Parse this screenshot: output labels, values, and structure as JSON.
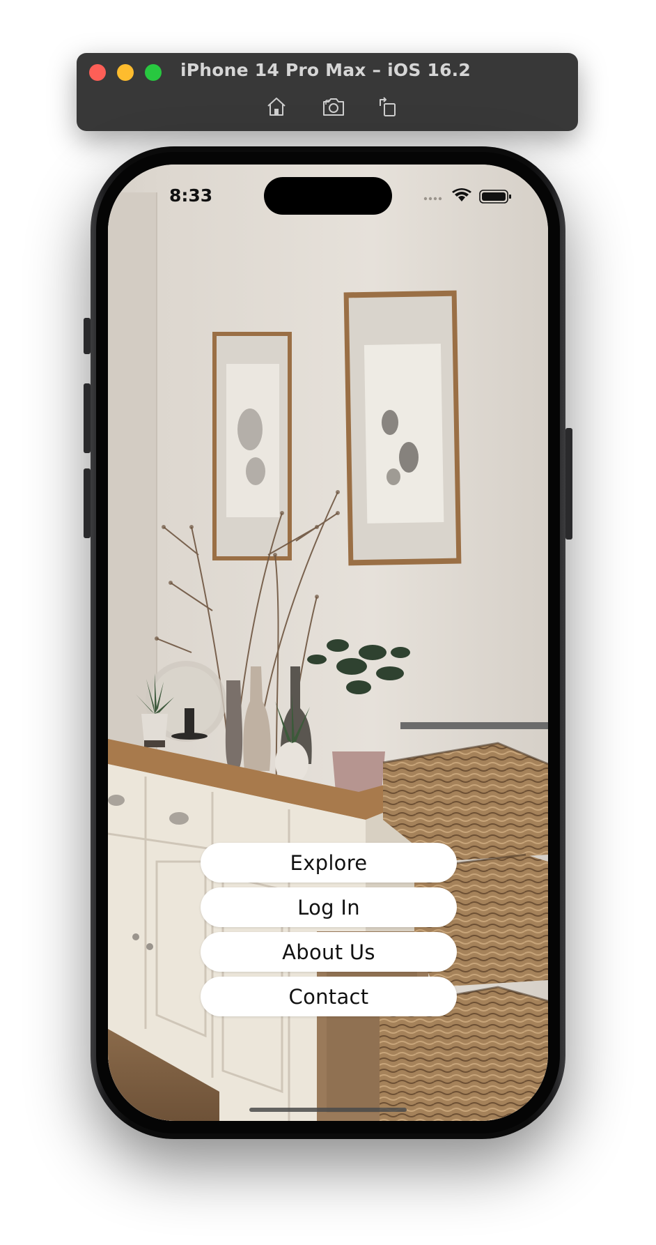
{
  "simulator": {
    "title": "iPhone 14 Pro Max – iOS 16.2",
    "tools": [
      "home-icon",
      "screenshot-icon",
      "rotate-icon"
    ]
  },
  "status_bar": {
    "time": "8:33",
    "icons": [
      "signal-icon",
      "wifi-icon",
      "battery-icon"
    ]
  },
  "menu": {
    "explore": "Explore",
    "login": "Log In",
    "about": "About Us",
    "contact": "Contact"
  },
  "colors": {
    "button_bg": "#ffffff",
    "button_text": "#111111",
    "wall": "#e2ddd6",
    "sideboard": "#ece6da",
    "wood_top": "#a87a4c",
    "wicker": "#a88458"
  }
}
